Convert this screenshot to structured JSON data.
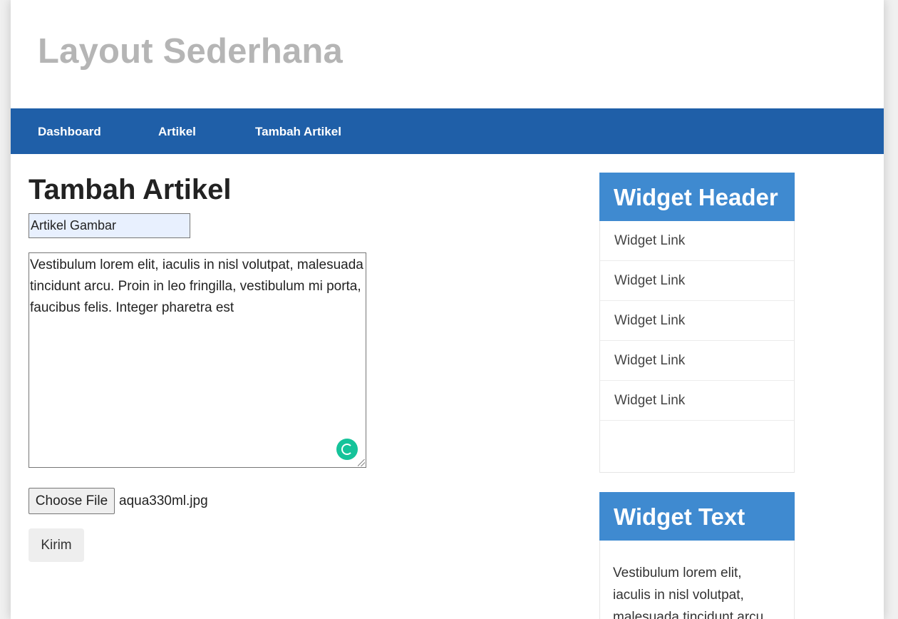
{
  "site": {
    "title": "Layout Sederhana"
  },
  "nav": {
    "items": [
      {
        "label": "Dashboard"
      },
      {
        "label": "Artikel"
      },
      {
        "label": "Tambah Artikel"
      }
    ]
  },
  "form": {
    "heading": "Tambah Artikel",
    "title_value": "Artikel Gambar",
    "content_value": "Vestibulum lorem elit, iaculis in nisl volutpat, malesuada tincidunt arcu. Proin in leo fringilla, vestibulum mi porta, faucibus felis. Integer pharetra est",
    "file_button_label": "Choose File",
    "file_name": "aqua330ml.jpg",
    "submit_label": "Kirim"
  },
  "sidebar": {
    "widget_links": {
      "header": "Widget Header",
      "links": [
        {
          "label": "Widget Link"
        },
        {
          "label": "Widget Link"
        },
        {
          "label": "Widget Link"
        },
        {
          "label": "Widget Link"
        },
        {
          "label": "Widget Link"
        }
      ]
    },
    "widget_text": {
      "header": "Widget Text",
      "body": "Vestibulum lorem elit, iaculis in nisl volutpat, malesuada tincidunt arcu."
    }
  },
  "colors": {
    "nav_bg": "#1f5fa8",
    "widget_header_bg": "#3f8ad0",
    "site_title": "#b5b5b5",
    "grammarly": "#15c39a"
  },
  "icons": {
    "grammarly": "grammarly-icon",
    "resize": "resize-grip-icon"
  }
}
